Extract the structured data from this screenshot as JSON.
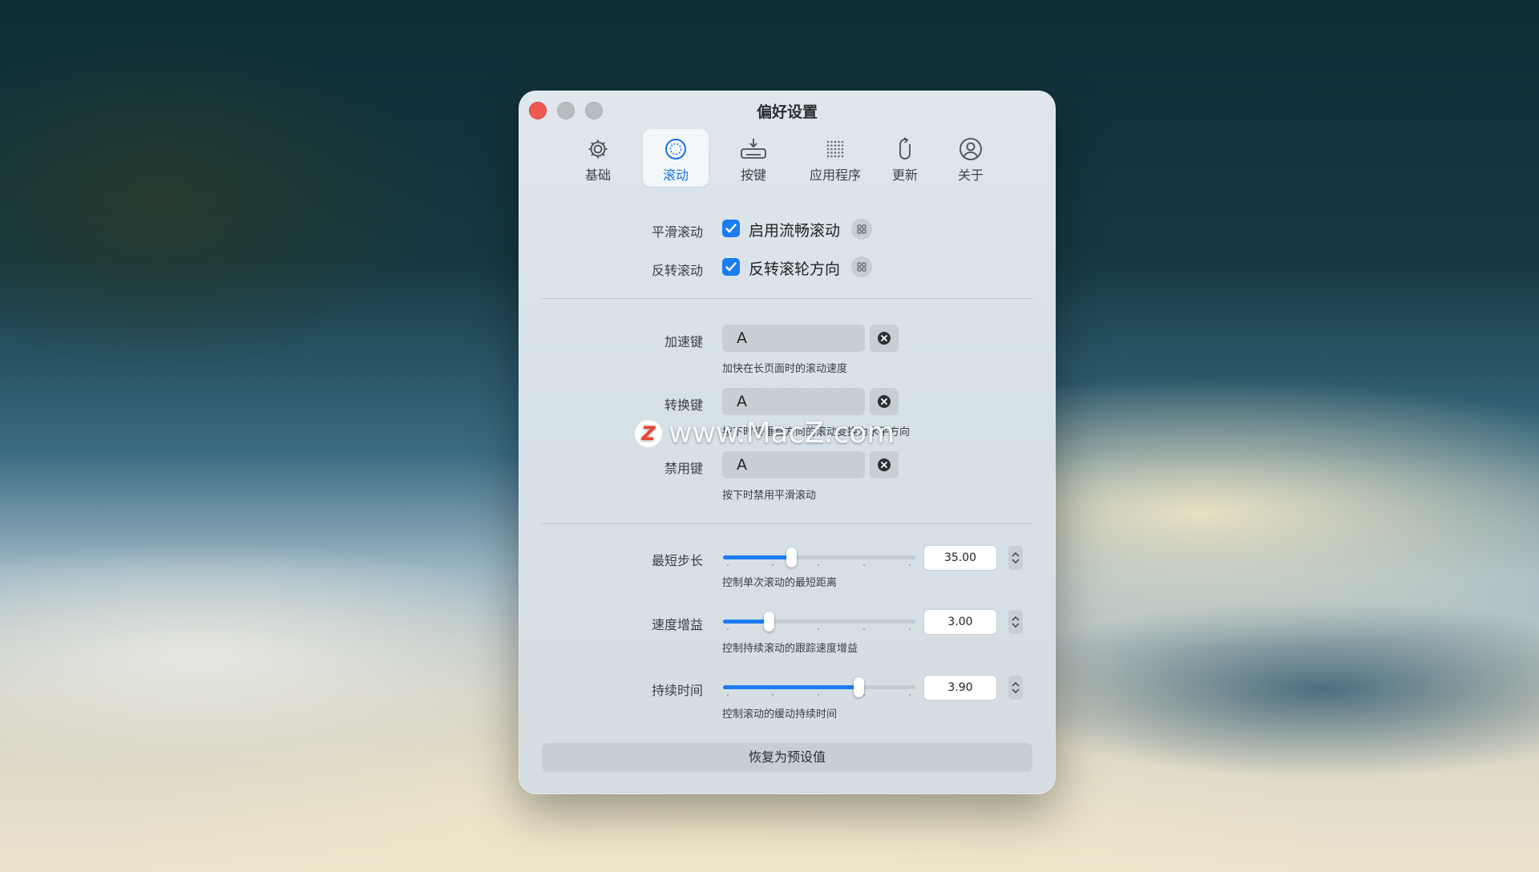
{
  "window": {
    "title": "偏好设置"
  },
  "tabs": [
    {
      "id": "basic",
      "label": "基础",
      "icon": "gear-icon"
    },
    {
      "id": "scroll",
      "label": "滚动",
      "icon": "scroll-icon",
      "active": true
    },
    {
      "id": "keys",
      "label": "按键",
      "icon": "keyboard-icon"
    },
    {
      "id": "apps",
      "label": "应用程序",
      "icon": "apps-grid-icon"
    },
    {
      "id": "update",
      "label": "更新",
      "icon": "mouse-refresh-icon"
    },
    {
      "id": "about",
      "label": "关于",
      "icon": "person-circle-icon"
    }
  ],
  "toggles": {
    "smooth": {
      "label": "平滑滚动",
      "text": "启用流畅滚动",
      "checked": true
    },
    "reverse": {
      "label": "反转滚动",
      "text": "反转滚轮方向",
      "checked": true
    }
  },
  "keys": {
    "accelerate": {
      "label": "加速键",
      "value": "A",
      "hint": "加快在长页面时的滚动速度"
    },
    "convert": {
      "label": "转换键",
      "value": "A",
      "hint": "按下时将垂直方向的滚动变换为水平方向"
    },
    "disable": {
      "label": "禁用键",
      "value": "A",
      "hint": "按下时禁用平滑滚动"
    }
  },
  "sliders": {
    "step": {
      "label": "最短步长",
      "value": "35.00",
      "fraction": 0.36,
      "hint": "控制单次滚动的最短距离"
    },
    "gain": {
      "label": "速度增益",
      "value": "3.00",
      "fraction": 0.24,
      "hint": "控制持续滚动的跟踪速度增益"
    },
    "duration": {
      "label": "持续时间",
      "value": "3.90",
      "fraction": 0.71,
      "hint": "控制滚动的缓动持续时间"
    }
  },
  "footer": {
    "reset_label": "恢复为预设值"
  },
  "watermark": {
    "text": "www.MacZ.com",
    "logo_letter": "Z"
  },
  "colors": {
    "accent": "#1b7cf0",
    "close": "#ee5a52"
  }
}
